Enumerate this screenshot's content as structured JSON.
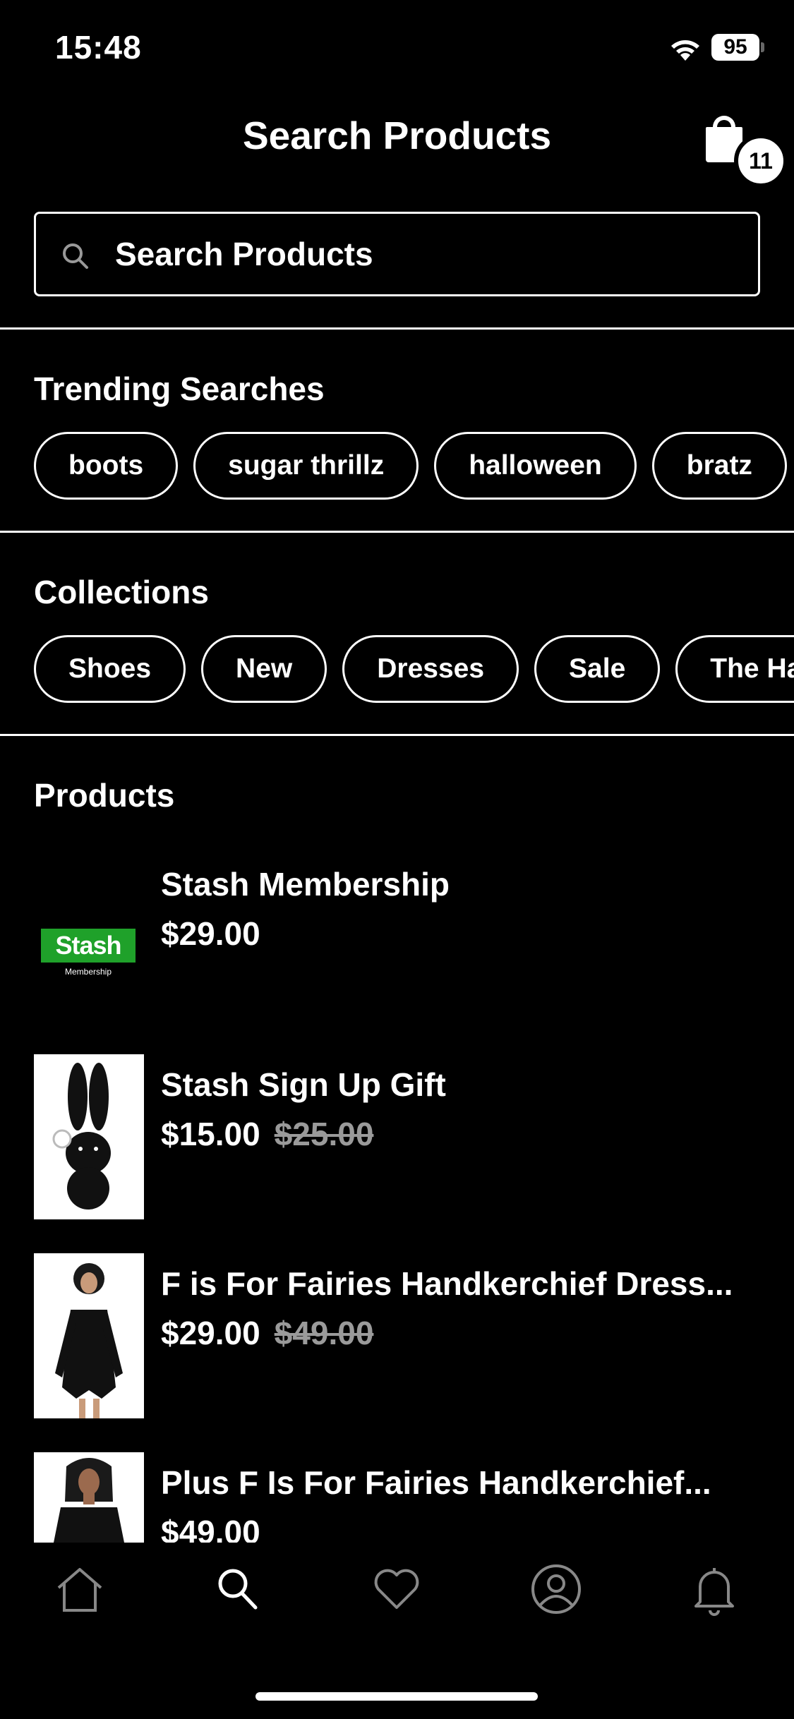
{
  "status_bar": {
    "time": "15:48",
    "battery": "95"
  },
  "header": {
    "title": "Search Products",
    "cart_count": "11"
  },
  "search": {
    "placeholder": "Search Products"
  },
  "trending": {
    "title": "Trending Searches",
    "items": [
      "boots",
      "sugar thrillz",
      "halloween",
      "bratz"
    ]
  },
  "collections": {
    "title": "Collections",
    "items": [
      "Shoes",
      "New",
      "Dresses",
      "Sale",
      "The Ha"
    ]
  },
  "products": {
    "title": "Products",
    "items": [
      {
        "name": "Stash Membership",
        "price": "$29.00",
        "old_price": "",
        "logo_text": "Stash",
        "logo_sub": "Membership"
      },
      {
        "name": "Stash Sign Up Gift",
        "price": "$15.00",
        "old_price": "$25.00"
      },
      {
        "name": "F is For Fairies Handkerchief Dress...",
        "price": "$29.00",
        "old_price": "$49.00"
      },
      {
        "name": "Plus F Is For Fairies Handkerchief...",
        "price": "$49.00",
        "old_price": ""
      }
    ]
  },
  "tab_bar": {
    "icons": [
      "home-icon",
      "search-icon",
      "heart-icon",
      "profile-icon",
      "bell-icon"
    ]
  },
  "colors": {
    "background": "#000000",
    "foreground": "#ffffff",
    "strike": "#9a9a9a",
    "stash_green": "#1fa12a"
  }
}
